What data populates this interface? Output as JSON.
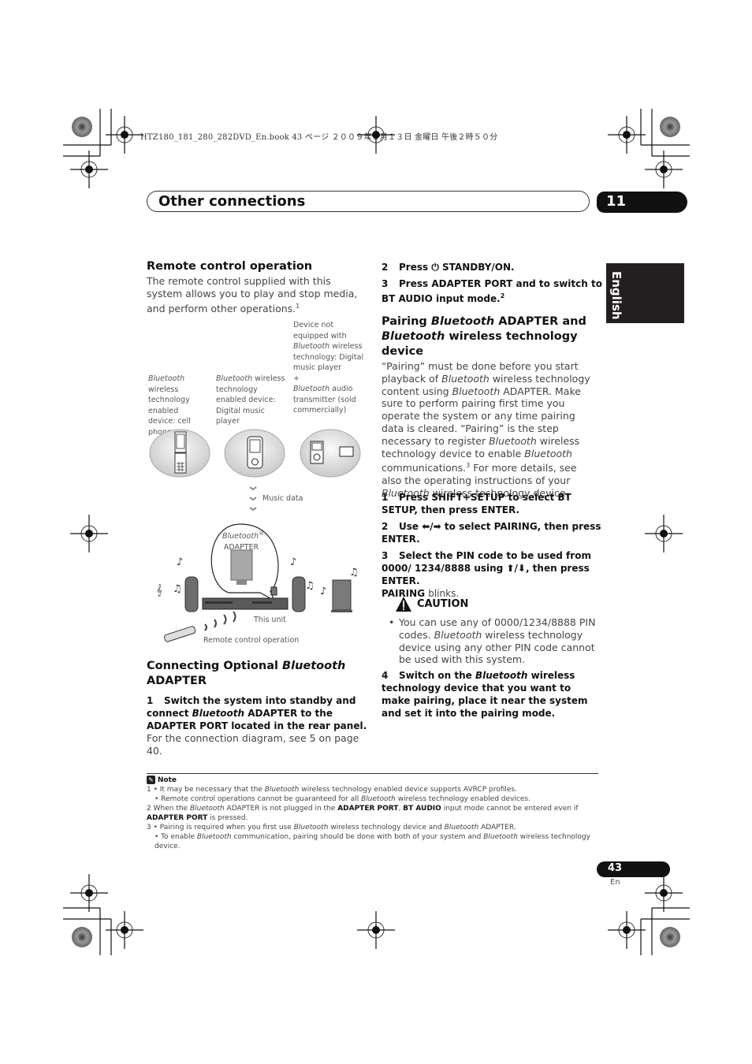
{
  "print_header": "HTZ180_181_280_282DVD_En.book  43 ページ  ２００９年３月１３日  金曜日  午後２時５０分",
  "title_bar": {
    "title": "Other connections",
    "chapter": "11"
  },
  "side_tab": {
    "language": "English"
  },
  "left": {
    "remote_heading": "Remote control operation",
    "remote_body": "The remote control supplied with this system allows you to play and stop media, and perform other operations.",
    "remote_body_footnote": "1",
    "diagram": {
      "device1_caption_italic": "Bluetooth",
      "device1_caption": "wireless technology enabled device: cell phone",
      "device2_caption_italic": "Bluetooth",
      "device2_caption": "wireless technology enabled device: Digital music player",
      "device3_caption_a": "Device not equipped with",
      "device3_caption_italic": "Bluetooth",
      "device3_caption_b": "wireless technology: Digital music player",
      "device3_plus": "+",
      "device3_caption_italic2": "Bluetooth",
      "device3_caption_c": "audio transmitter (sold commercially)",
      "plus_sign": "+",
      "music_data": "Music data",
      "adapter_italic": "Bluetooth",
      "adapter_reg": "®",
      "adapter_label": "ADAPTER",
      "this_unit": "This unit",
      "remote_op": "Remote control operation"
    },
    "connecting_heading_a": "Connecting Optional",
    "connecting_heading_italic": "Bluetooth",
    "connecting_heading_b": "ADAPTER",
    "step1_num": "1",
    "step1_a": "Switch the system into standby and connect",
    "step1_italic": "Bluetooth",
    "step1_b": "ADAPTER to the ADAPTER PORT located in the rear panel.",
    "step1_body": "For the connection diagram, see 5 on page 40."
  },
  "right": {
    "step2_num": "2",
    "step2_a": "Press",
    "step2_b": "STANDBY/ON.",
    "step3_num": "3",
    "step3": "Press ADAPTER PORT and to switch to BT AUDIO input mode.",
    "step3_footnote": "2",
    "pairing_heading_a": "Pairing",
    "pairing_heading_italic1": "Bluetooth",
    "pairing_heading_b": "ADAPTER and",
    "pairing_heading_italic2": "Bluetooth",
    "pairing_heading_c": "wireless technology device",
    "pairing_body": [
      {
        "t": "“Pairing” must be done before you start playback of "
      },
      {
        "i": "Bluetooth"
      },
      {
        "t": " wireless technology content using "
      },
      {
        "i": "Bluetooth"
      },
      {
        "t": " ADAPTER. Make sure to perform pairing first time you operate the system or any time pairing data is cleared. “Pairing” is the step necessary to register "
      },
      {
        "i": "Bluetooth"
      },
      {
        "t": " wireless technology device to enable "
      },
      {
        "i": "Bluetooth"
      },
      {
        "t": " communications."
      },
      {
        "sup": "3"
      },
      {
        "t": " For more details, see also the operating instructions of your "
      },
      {
        "i": "Bluetooth"
      },
      {
        "t": " wireless technology device."
      }
    ],
    "pstep1_num": "1",
    "pstep1": "Press SHIFT+SETUP to select BT SETUP, then press ENTER.",
    "pstep2_num": "2",
    "pstep2_a": "Use",
    "pstep2_arrows": "⬅/➡",
    "pstep2_b": "to select PAIRING, then press ENTER.",
    "pstep3_num": "3",
    "pstep3_a": "Select the PIN code to be used from 0000/ 1234/8888 using",
    "pstep3_arrows": "⬆/⬇",
    "pstep3_b": ", then press ENTER.",
    "pstep3_bold": "PAIRING",
    "pstep3_tail": "blinks.",
    "caution_label": "CAUTION",
    "caution_a": "You can use any of 0000/1234/8888 PIN codes.",
    "caution_italic": "Bluetooth",
    "caution_b": "wireless technology device using any other PIN code cannot be used with this system.",
    "pstep4_num": "4",
    "pstep4_a": "Switch on the",
    "pstep4_italic": "Bluetooth",
    "pstep4_b": "wireless technology device that you want to make pairing, place it near the system and set it into the pairing mode."
  },
  "notes": {
    "label": "Note",
    "n1a_num": "1",
    "n1a_pre": "It may be necessary that the",
    "n1a_italic": "Bluetooth",
    "n1a_post": "wireless technology enabled device supports AVRCP profiles.",
    "n1b_pre": "Remote control operations cannot be guaranteed for all",
    "n1b_italic": "Bluetooth",
    "n1b_post": "wireless technology enabled devices.",
    "n2_num": "2",
    "n2_pre": "When the",
    "n2_italic": "Bluetooth",
    "n2_mid": "ADAPTER is not plugged in the",
    "n2_bold1": "ADAPTER PORT",
    "n2_comma": ",",
    "n2_bold2": "BT AUDIO",
    "n2_post": "input mode cannot be entered even if",
    "n2_bold3": "ADAPTER PORT",
    "n2_end": "is pressed.",
    "n3a_num": "3",
    "n3a_pre": "Pairing is required when you first use",
    "n3a_italic": "Bluetooth",
    "n3a_mid": "wireless technology device and",
    "n3a_italic2": "Bluetooth",
    "n3a_post": "ADAPTER.",
    "n3b_pre": "To enable",
    "n3b_italic": "Bluetooth",
    "n3b_mid": "communication, pairing should be done with both of your system and",
    "n3b_italic2": "Bluetooth",
    "n3b_post": "wireless technology device."
  },
  "footer": {
    "page_number": "43",
    "lang_code": "En"
  }
}
